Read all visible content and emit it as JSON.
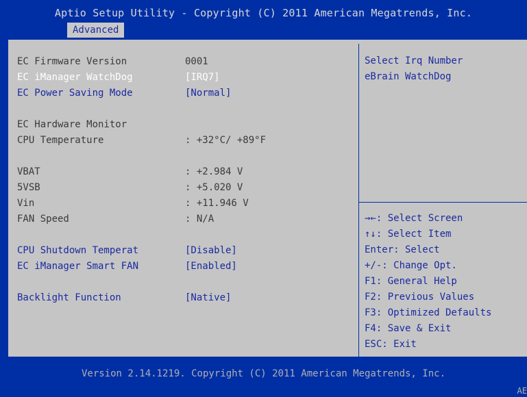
{
  "header": {
    "title": "Aptio Setup Utility - Copyright (C) 2011 American Megatrends, Inc.",
    "tab": "Advanced"
  },
  "settings": {
    "items": [
      {
        "label": "EC Firmware Version",
        "value": "0001"
      },
      {
        "label": "EC iManager WatchDog",
        "value": "[IRQ7]"
      },
      {
        "label": "EC Power Saving Mode",
        "value": "[Normal]"
      },
      {
        "label": "EC Hardware Monitor",
        "value": ""
      },
      {
        "label": "CPU Temperature",
        "value": ": +32°C/ +89°F"
      },
      {
        "label": "VBAT",
        "value": ": +2.984 V"
      },
      {
        "label": "5VSB",
        "value": ": +5.020 V"
      },
      {
        "label": "Vin",
        "value": ": +11.946 V"
      },
      {
        "label": "FAN Speed",
        "value": ": N/A"
      },
      {
        "label": "CPU Shutdown Temperat",
        "value": "[Disable]"
      },
      {
        "label": "EC iManager Smart FAN",
        "value": "[Enabled]"
      },
      {
        "label": "Backlight Function",
        "value": "[Native]"
      }
    ]
  },
  "help": {
    "line1": "Select Irq Number",
    "line2": "eBrain WatchDog"
  },
  "keys": {
    "select_screen": "→←: Select Screen",
    "select_item": "↑↓: Select Item",
    "enter": "Enter: Select",
    "change": "+/-: Change Opt.",
    "f1": "F1: General Help",
    "f2": "F2: Previous Values",
    "f3": "F3: Optimized Defaults",
    "f4": "F4: Save & Exit",
    "esc": "ESC: Exit"
  },
  "footer": {
    "version": "Version 2.14.1219. Copyright (C) 2011 American Megatrends, Inc.",
    "corner": "AE"
  },
  "colors": {
    "background": "#002fa5",
    "panel": "#c5c5c5",
    "selected_text": "#ffffff",
    "link_text": "#1a2aa0"
  }
}
